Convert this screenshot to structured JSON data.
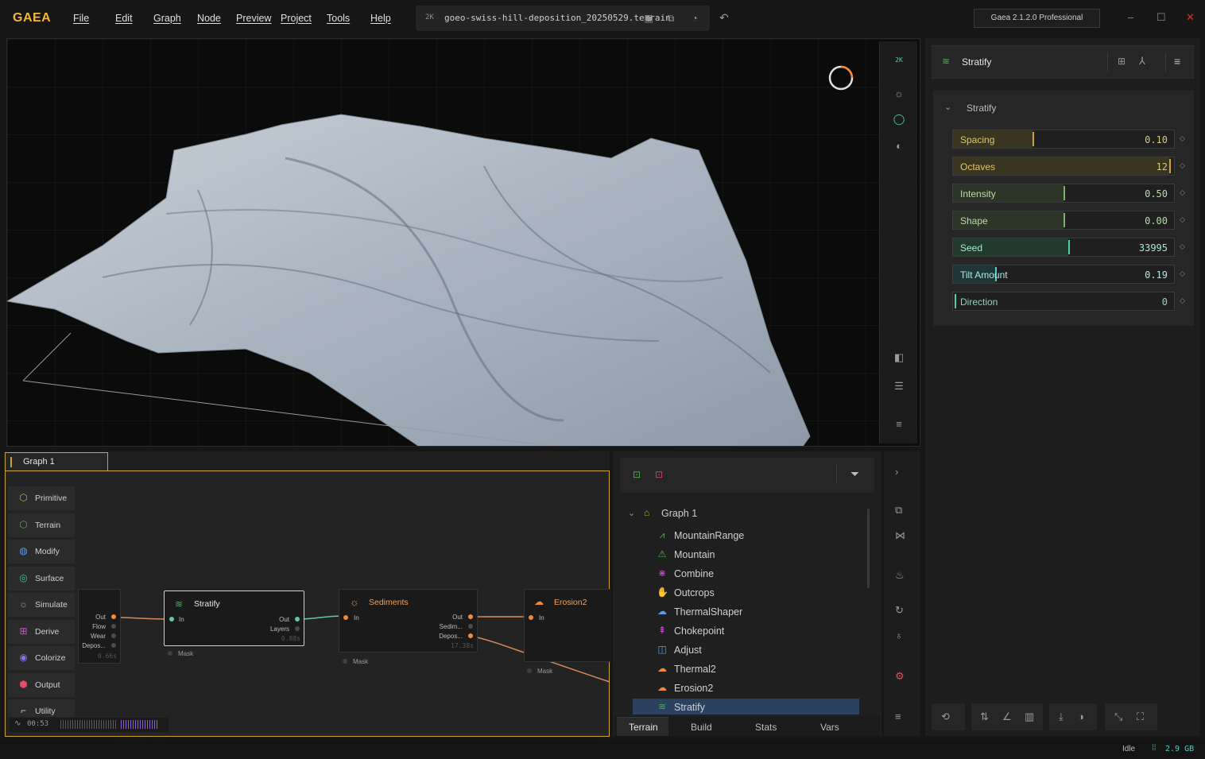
{
  "app": {
    "logo": "GAEA",
    "menu": [
      "File",
      "Edit",
      "Graph",
      "Node",
      "Preview",
      "Project",
      "Tools",
      "Help"
    ],
    "file_res": "2K",
    "file_name": "goeo-swiss-hill-deposition_20250529.terrain",
    "version": "Gaea 2.1.2.0 Professional"
  },
  "viewport": {
    "res_label": "2K"
  },
  "graph": {
    "tab_label": "Graph 1",
    "palette": [
      {
        "label": "Primitive",
        "icon": "cube-icon",
        "color": "#8bc34a"
      },
      {
        "label": "Terrain",
        "icon": "terrain-icon",
        "color": "#4caf50"
      },
      {
        "label": "Modify",
        "icon": "modify-icon",
        "color": "#5c9ded"
      },
      {
        "label": "Surface",
        "icon": "surface-icon",
        "color": "#2ec4a6"
      },
      {
        "label": "Simulate",
        "icon": "sun-icon",
        "color": "#f08a3a"
      },
      {
        "label": "Derive",
        "icon": "derive-icon",
        "color": "#d34fd6"
      },
      {
        "label": "Colorize",
        "icon": "colorize-icon",
        "color": "#8a6ff0"
      },
      {
        "label": "Output",
        "icon": "output-icon",
        "color": "#e84a5f"
      },
      {
        "label": "Utility",
        "icon": "utility-icon",
        "color": "#cccccc"
      }
    ],
    "partial_node": {
      "ports": [
        "Out",
        "Flow",
        "Wear",
        "Depos..."
      ],
      "time": "0.66s"
    },
    "stratify_node": {
      "title": "Stratify",
      "in": "In",
      "out": "Out",
      "layers": "Layers",
      "time": "0.88s",
      "mask": "Mask"
    },
    "sediments_node": {
      "title": "Sediments",
      "in": "In",
      "out": "Out",
      "sedim": "Sedim...",
      "depos": "Depos...",
      "time": "17.38s",
      "mask": "Mask"
    },
    "erosion_node": {
      "title": "Erosion2",
      "in": "In",
      "mask": "Mask"
    },
    "footer_time": "00:53"
  },
  "tree": {
    "root": "Graph 1",
    "items": [
      {
        "label": "MountainRange",
        "color": "#4caf50"
      },
      {
        "label": "Mountain",
        "color": "#4caf50"
      },
      {
        "label": "Combine",
        "color": "#d34fd6"
      },
      {
        "label": "Outcrops",
        "color": "#4caf50"
      },
      {
        "label": "ThermalShaper",
        "color": "#5c9ded"
      },
      {
        "label": "Chokepoint",
        "color": "#d34fd6"
      },
      {
        "label": "Adjust",
        "color": "#5c9ded"
      },
      {
        "label": "Thermal2",
        "color": "#f08a3a"
      },
      {
        "label": "Erosion2",
        "color": "#f08a3a"
      },
      {
        "label": "Stratify",
        "color": "#4caf50"
      }
    ],
    "tabs": [
      "Terrain",
      "Build",
      "Stats",
      "Vars"
    ],
    "active_tab": "Terrain"
  },
  "properties": {
    "node_name": "Stratify",
    "section": "Stratify",
    "params": [
      {
        "label": "Spacing",
        "value": "0.10",
        "fraction": 0.36,
        "accent": "#c8a536",
        "fill": "#3a3520",
        "text": "#e0c46a"
      },
      {
        "label": "Octaves",
        "value": "12",
        "fraction": 0.98,
        "accent": "#c8a536",
        "fill": "#3a3520",
        "text": "#e0c46a"
      },
      {
        "label": "Intensity",
        "value": "0.50",
        "fraction": 0.5,
        "accent": "#7fb26a",
        "fill": "#2c3527",
        "text": "#b9dca8"
      },
      {
        "label": "Shape",
        "value": "0.00",
        "fraction": 0.5,
        "accent": "#7fb26a",
        "fill": "#2c3527",
        "text": "#b9dca8"
      },
      {
        "label": "Seed",
        "value": "33995",
        "fraction": 0.52,
        "accent": "#4fd0a0",
        "fill": "#21392f",
        "text": "#a9e8cf"
      },
      {
        "label": "Tilt Amount",
        "value": "0.19",
        "fraction": 0.19,
        "accent": "#4fd0c8",
        "fill": "#1f3638",
        "text": "#a9e8e8"
      },
      {
        "label": "Direction",
        "value": "0",
        "fraction": 0.0,
        "accent": "#4fd0a0",
        "fill": "#21392f",
        "text": "#8fd4bd"
      }
    ]
  },
  "status": {
    "state": "Idle",
    "memory": "2.9 GB"
  }
}
